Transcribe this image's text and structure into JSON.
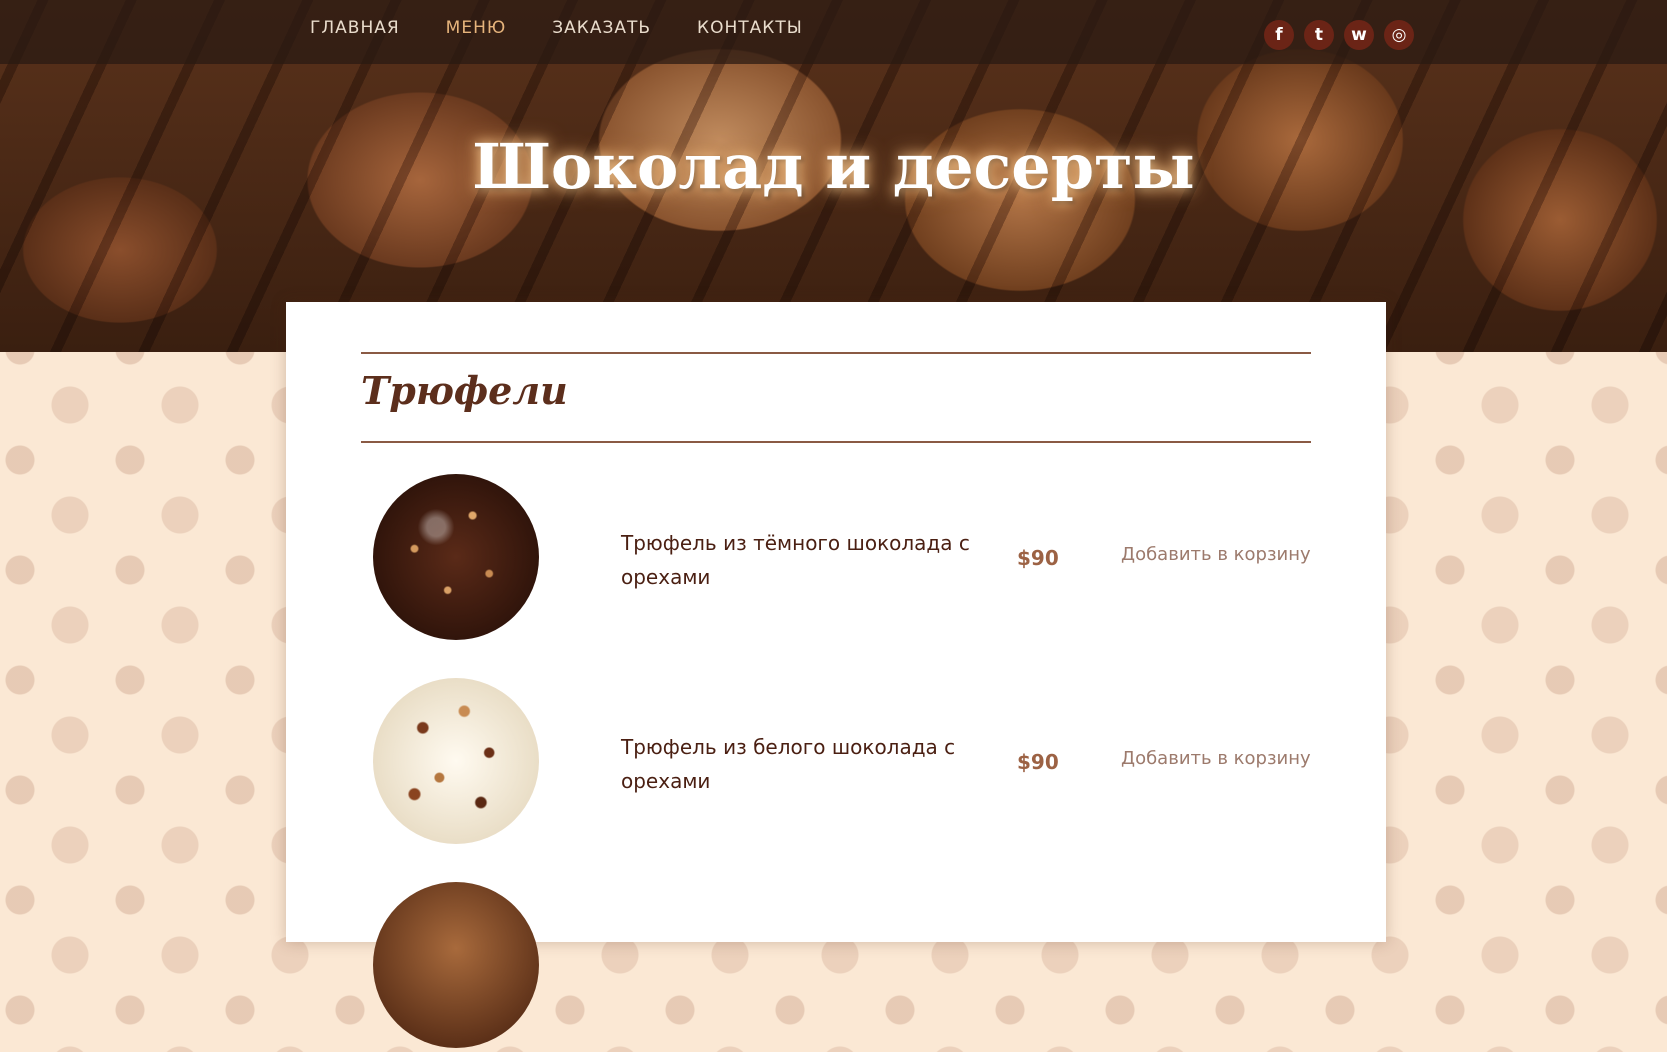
{
  "nav": {
    "items": [
      {
        "label": "ГЛАВНАЯ",
        "active": false
      },
      {
        "label": "МЕНЮ",
        "active": true
      },
      {
        "label": "ЗАКАЗАТЬ",
        "active": false
      },
      {
        "label": "КОНТАКТЫ",
        "active": false
      }
    ],
    "active_color": "#e6b47c"
  },
  "social": [
    {
      "icon": "facebook-icon",
      "glyph": "f"
    },
    {
      "icon": "twitter-icon",
      "glyph": "t"
    },
    {
      "icon": "whatsapp-icon",
      "glyph": "w"
    },
    {
      "icon": "instagram-icon",
      "glyph": "◎"
    }
  ],
  "hero": {
    "title": "Шоколад и десерты"
  },
  "section": {
    "title": "Трюфели"
  },
  "products": [
    {
      "name": "Трюфель из тёмного шоколада с орехами",
      "price": "$90",
      "cta": "Добавить в корзину"
    },
    {
      "name": "Трюфель из белого шоколада с орехами",
      "price": "$90",
      "cta": "Добавить в корзину"
    }
  ],
  "colors": {
    "brand_dark": "#4a1f12",
    "accent": "#9c6244",
    "card_bg": "#ffffff",
    "page_bg": "#fbe8d4"
  }
}
